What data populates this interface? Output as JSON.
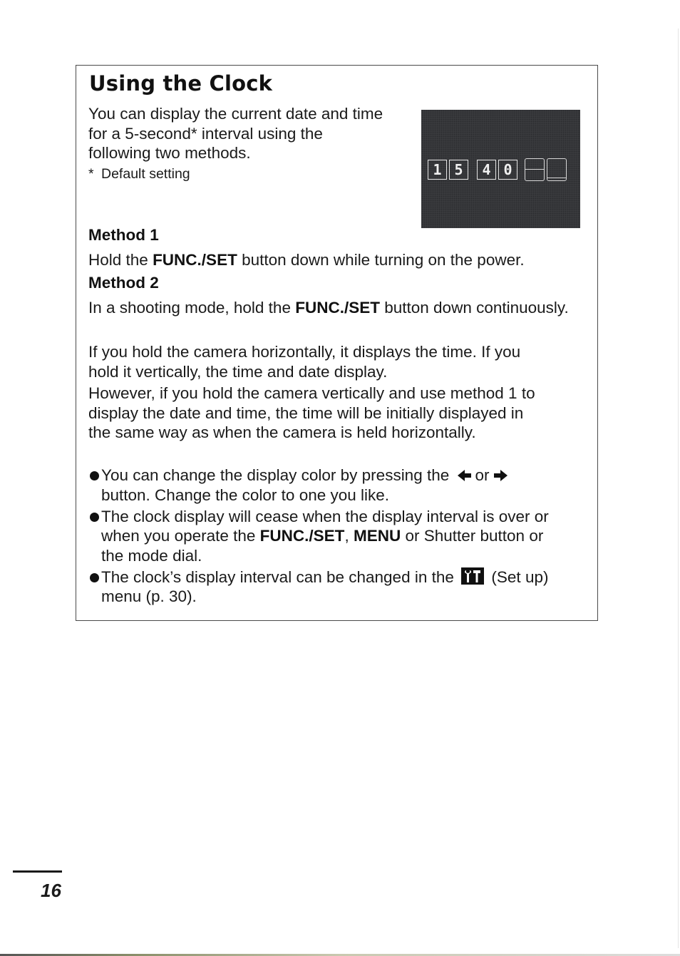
{
  "title": "Using the Clock",
  "intro": {
    "lines": [
      "You can display the current date and time",
      "for a 5-second* interval using the",
      "following two methods."
    ],
    "footnote_marker": "*",
    "footnote": "Default setting"
  },
  "clock_display": {
    "digits": [
      "1",
      "5",
      "4",
      "0"
    ],
    "time": "15:40",
    "background_color": "#3c3d40",
    "digit_color": "#f0f0f0"
  },
  "methods": [
    {
      "heading": "Method 1",
      "text_before": "Hold the ",
      "bold": "FUNC./SET",
      "text_after": " button down while turning on the power."
    },
    {
      "heading": "Method 2",
      "text_before": "In a shooting mode, hold the ",
      "bold": "FUNC./SET",
      "text_after": " button down continuously."
    }
  ],
  "paragraphs": [
    {
      "lines": [
        "If you hold the camera horizontally, it displays the time. If you",
        "hold it vertically, the time and date display."
      ]
    },
    {
      "lines": [
        "However, if you hold the camera vertically and use method 1 to",
        "display the date and time, the time will be initially displayed in",
        "the same way as when the camera is held horizontally."
      ]
    }
  ],
  "bullets": [
    {
      "part1": "You can change the display color by pressing the",
      "or": "or",
      "line2": "button. Change the color to one you like.",
      "icons": [
        "left-arrow-icon",
        "right-arrow-icon"
      ]
    },
    {
      "line1": "The clock display will cease when the display interval is over or",
      "line2_before": "when you operate the ",
      "bold1": "FUNC./SET",
      "sep": ", ",
      "bold2": "MENU",
      "line2_after": " or Shutter button or",
      "line3": "the mode dial."
    },
    {
      "part1": "The clock’s display interval can be changed in the",
      "icon": "setup-menu-icon",
      "part2": "(Set up)",
      "line2": "menu (p. 30)."
    }
  ],
  "page_number": "16"
}
